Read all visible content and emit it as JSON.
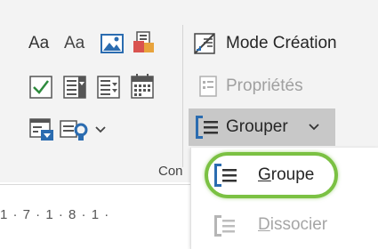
{
  "ribbon": {
    "aa_large": "Aa",
    "aa_small": "Aa",
    "mode_creation": "Mode Création",
    "proprietes": "Propriétés",
    "grouper": "Grouper",
    "group_label": "Con"
  },
  "menu": {
    "groupe_first": "G",
    "groupe_rest": "roupe",
    "dissocier_first": "D",
    "dissocier_rest": "issocier"
  },
  "ruler": {
    "text": "1 · 7 · 1 · 8 · 1 ·"
  },
  "colors": {
    "highlight": "#7bc143",
    "accent_blue": "#2b6cb0",
    "checkbox_green": "#2e8b3d",
    "ribbon_bg": "#f3f3f3",
    "pressed_bg": "#c8c8c8"
  },
  "icons": [
    "image-content-control-icon",
    "building-block-icon",
    "checkbox-content-control-icon",
    "combo-box-icon",
    "dropdown-list-icon",
    "date-picker-icon",
    "legacy-tools-icon",
    "repeating-section-icon",
    "mode-creation-icon",
    "properties-icon",
    "group-icon",
    "ungroup-icon"
  ]
}
